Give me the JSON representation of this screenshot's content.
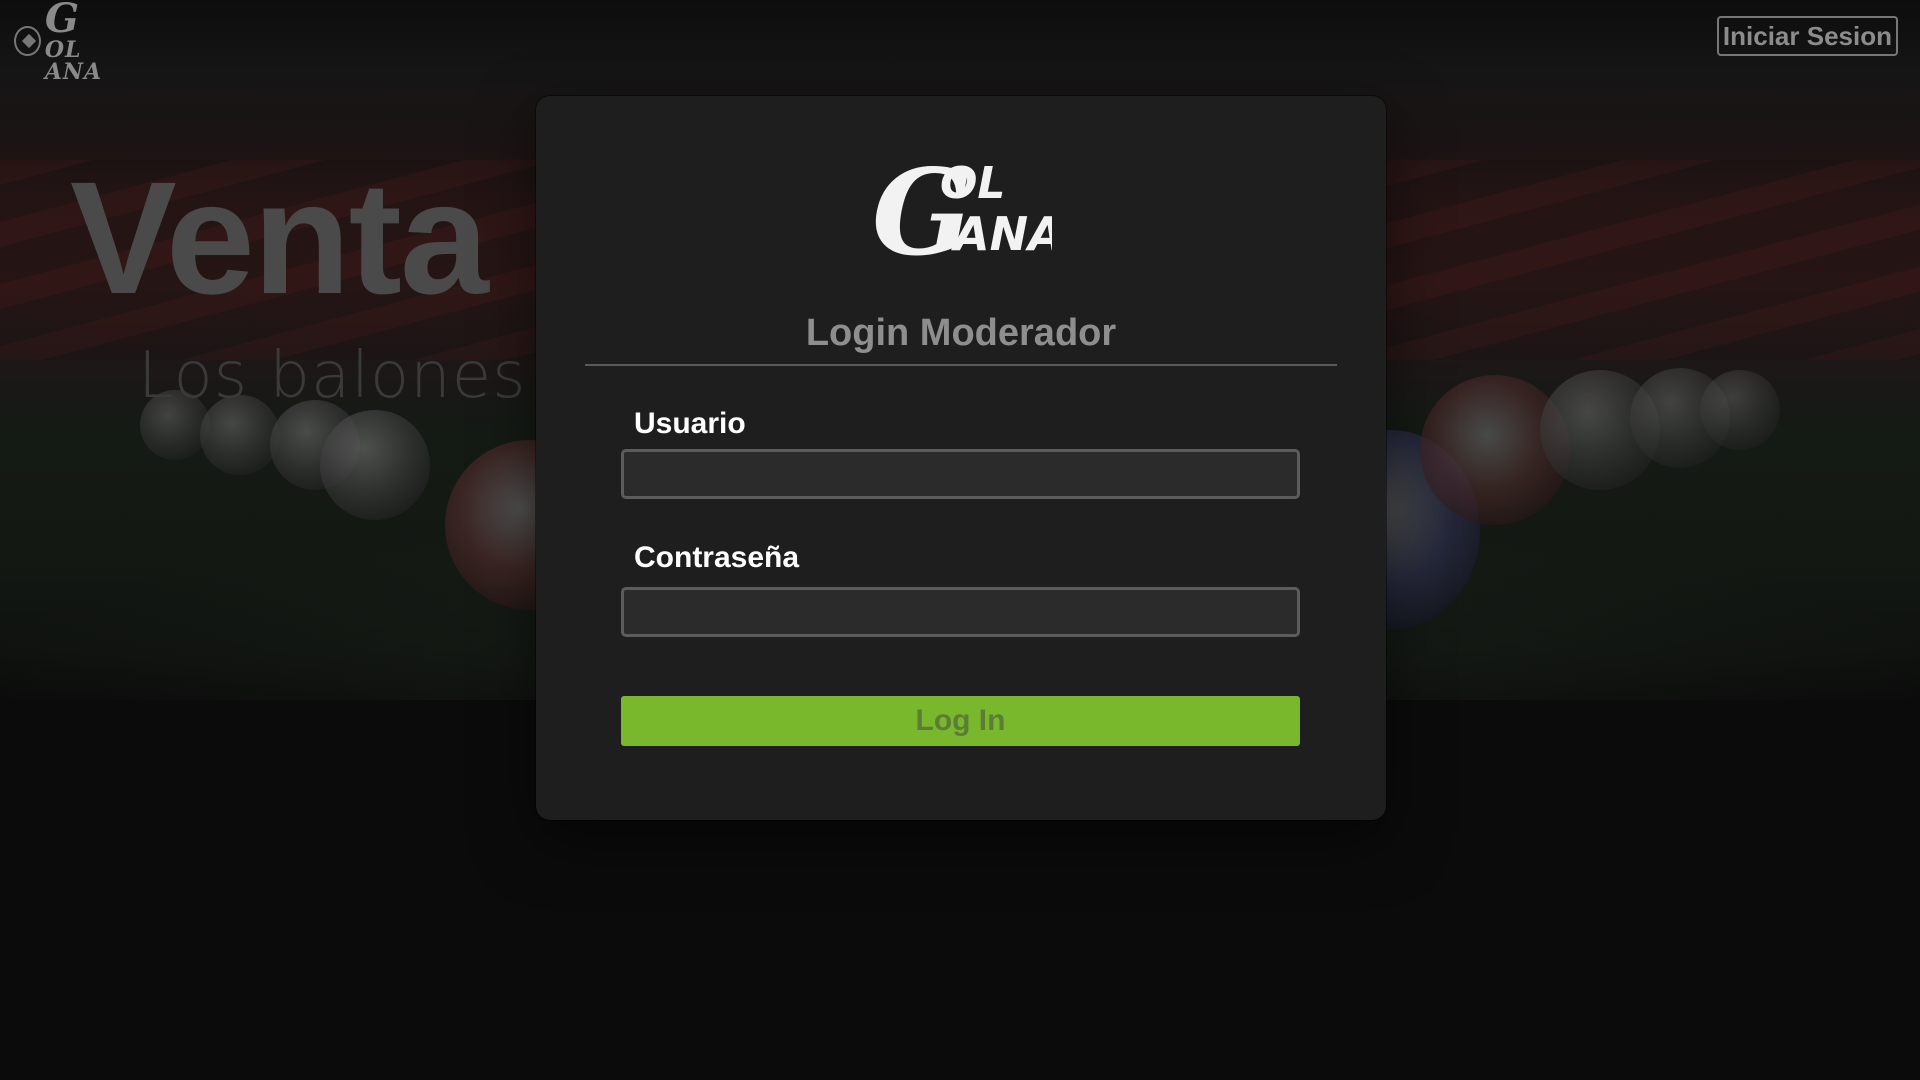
{
  "header": {
    "logo_alt": "Gol Gana",
    "logo_text_top": "OL",
    "logo_text_bottom": "ANA",
    "logo_letter": "G",
    "login_button_label": "Iniciar Sesion"
  },
  "hero": {
    "title": "Venta",
    "subtitle": "Los balones"
  },
  "modal": {
    "logo_letter": "G",
    "logo_text_top": "OL",
    "logo_text_bottom": "ANA",
    "title": "Login Moderador",
    "username_label": "Usuario",
    "username_value": "",
    "password_label": "Contraseña",
    "password_value": "",
    "submit_label": "Log In"
  },
  "colors": {
    "accent": "#79b72c",
    "modal_bg": "#1e1e1e",
    "page_bg": "#0b0b0b"
  }
}
